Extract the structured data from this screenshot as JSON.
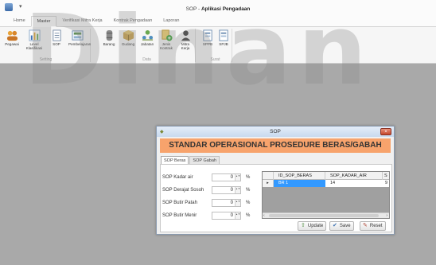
{
  "window": {
    "title_prefix": "SOP - ",
    "app_name": "Aplikasi Pengadaan",
    "qat_arrow": "▾"
  },
  "ribbon_tabs": [
    "Home",
    "Master",
    "Verifikasi Mitra Kerja",
    "Kontrak Pengadaan",
    "Laporan"
  ],
  "ribbon": {
    "setting": {
      "label": "Setting",
      "buttons": [
        "Pegawai",
        "Level Klasifikasi",
        "SOP",
        "Pembelajaran"
      ]
    },
    "data": {
      "label": "Data",
      "buttons": [
        "Barang",
        "Gudang",
        "Jabatan",
        "Jenis Kontrak",
        "Mitra Kerja"
      ]
    },
    "surat": {
      "label": "Surat",
      "buttons": [
        "SPPB",
        "SPJB"
      ]
    }
  },
  "watermark": "Dinan",
  "dialog": {
    "title": "SOP",
    "close": "×",
    "banner": "STANDAR OPERASIONAL PROSEDURE BERAS/GABAH",
    "tabs": [
      "SOP Beras",
      "SOP Gabah"
    ],
    "fields": [
      {
        "label": "SOP Kadar air",
        "value": "0",
        "unit": "%"
      },
      {
        "label": "SOP Derajat Sosoh",
        "value": "0",
        "unit": "%"
      },
      {
        "label": "SOP Butir Patah",
        "value": "0",
        "unit": "%"
      },
      {
        "label": "SOP Butir Menir",
        "value": "0",
        "unit": "%"
      }
    ],
    "spin_arrows": "▲▼",
    "grid": {
      "columns": [
        "ID_SOP_BERAS",
        "SOP_KADAR_AIR",
        "S"
      ],
      "row_indicator": "▸",
      "rows": [
        [
          "BR 1",
          "14",
          "9"
        ]
      ],
      "scroll_left": "‹",
      "scroll_right": "›"
    },
    "buttons": {
      "update": "Update",
      "save": "Save",
      "reset": "Reset"
    }
  }
}
